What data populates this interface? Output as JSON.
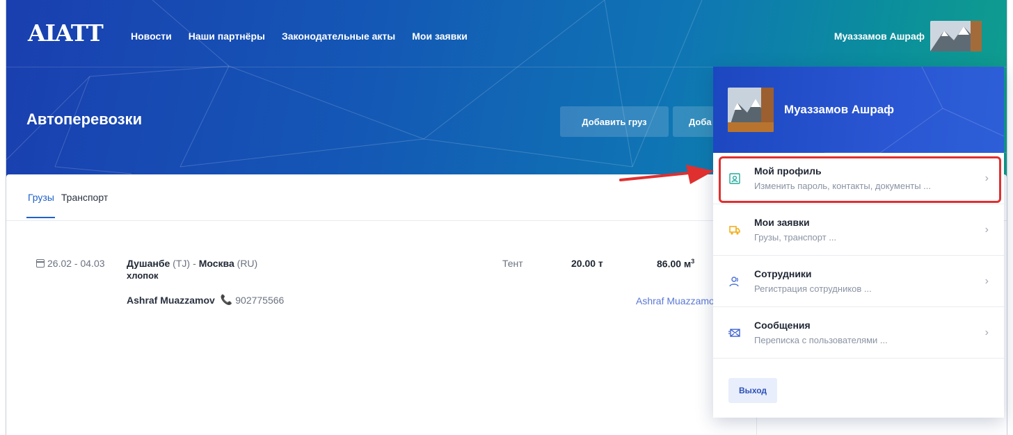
{
  "header": {
    "logo": "AIATT",
    "nav": [
      "Новости",
      "Наши партнёры",
      "Законодательные акты",
      "Мои заявки"
    ],
    "user_name": "Муаззамов Ашраф"
  },
  "page": {
    "title": "Автоперевозки",
    "btn_add_cargo": "Добавить груз",
    "btn_add_second": "Доба"
  },
  "tabs": [
    "Грузы",
    "Транспорт"
  ],
  "listing": {
    "date": "26.02 - 04.03",
    "from_city": "Душанбе",
    "from_cc": "(TJ)",
    "to_city": "Москва",
    "to_cc": "(RU)",
    "route_sep": "-",
    "cargo": "хлопок",
    "contact_name": "Ashraf Muazzamov",
    "phone": "902775566",
    "type": "Тент",
    "weight": "20.00 т",
    "volume": "86.00 м",
    "volume_unit_sup": "3",
    "link_name": "Ashraf Muazzamov"
  },
  "dropdown": {
    "name": "Муаззамов Ашраф",
    "items": [
      {
        "title": "Мой профиль",
        "sub": "Изменить пароль, контакты, документы ...",
        "icon": "profile-card-icon"
      },
      {
        "title": "Мои заявки",
        "sub": "Грузы, транспорт ...",
        "icon": "truck-icon"
      },
      {
        "title": "Сотрудники",
        "sub": "Регистрация сотрудников ...",
        "icon": "users-icon"
      },
      {
        "title": "Сообщения",
        "sub": "Переписка с пользователями ...",
        "icon": "envelope-icon"
      }
    ],
    "chevron": "›",
    "logout": "Выход"
  },
  "colors": {
    "brand": "#1f61c9",
    "highlight": "#e02f2f",
    "header_gradient_start": "#1a3fb0",
    "header_gradient_end": "#10a08a"
  }
}
